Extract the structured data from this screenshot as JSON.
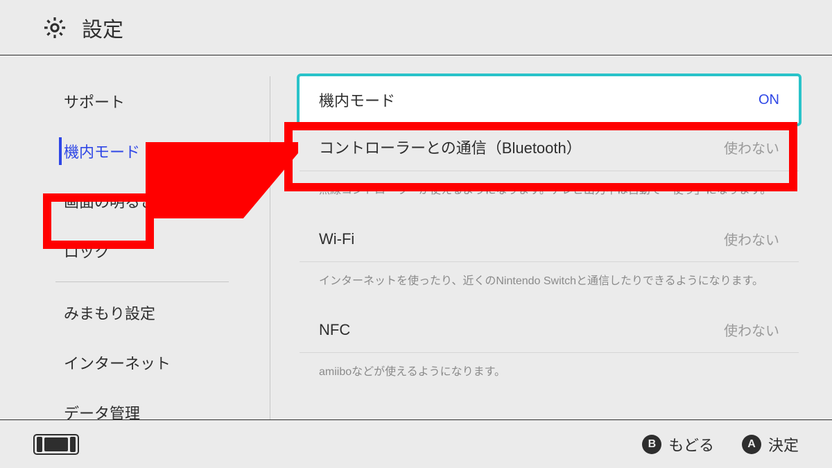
{
  "header": {
    "title": "設定"
  },
  "sidebar": {
    "items": [
      {
        "label": "サポート",
        "selected": false
      },
      {
        "label": "機内モード",
        "selected": true
      },
      {
        "label": "画面の明るさ",
        "selected": false
      },
      {
        "label": "ロック",
        "selected": false
      },
      {
        "label": "みまもり設定",
        "selected": false
      },
      {
        "label": "インターネット",
        "selected": false
      },
      {
        "label": "データ管理",
        "selected": false
      }
    ]
  },
  "main": {
    "groups": [
      {
        "label": "機内モード",
        "value": "ON",
        "focused": true,
        "desc": ""
      },
      {
        "label": "コントローラーとの通信（Bluetooth）",
        "value": "使わない",
        "desc": "無線コントローラーが使えるようになります。テレビ出力中は自動で「使う」になります。"
      },
      {
        "label": "Wi-Fi",
        "value": "使わない",
        "desc": "インターネットを使ったり、近くのNintendo Switchと通信したりできるようになります。"
      },
      {
        "label": "NFC",
        "value": "使わない",
        "desc": "amiiboなどが使えるようになります。"
      }
    ]
  },
  "footer": {
    "hints": [
      {
        "btn": "B",
        "label": "もどる"
      },
      {
        "btn": "A",
        "label": "決定"
      }
    ]
  }
}
